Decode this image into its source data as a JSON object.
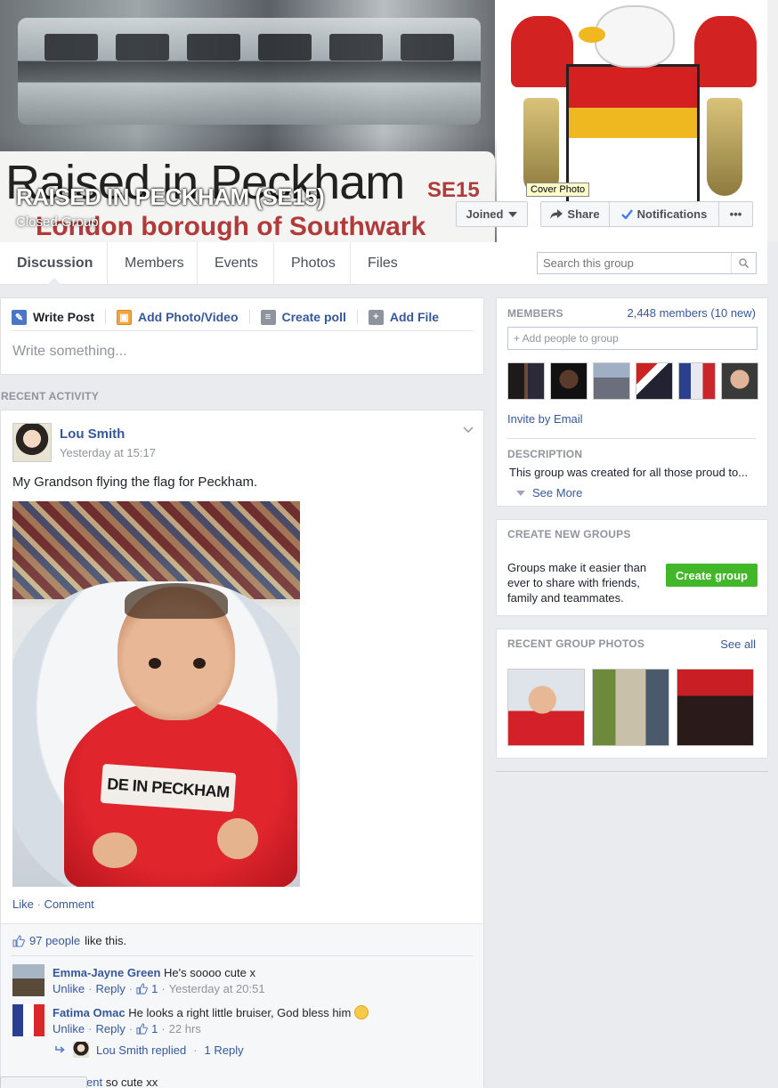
{
  "cover": {
    "sign_text": "Raised in Peckham",
    "sign_code": "SE15",
    "sign_subtext": "London borough of Southwark",
    "tooltip": "Cover Photo"
  },
  "group": {
    "title": "RAISED IN PECKHAM (SE15)",
    "type": "Closed Group"
  },
  "actions": {
    "joined": "Joined",
    "share": "Share",
    "notifications": "Notifications",
    "more": "•••"
  },
  "tabs": [
    {
      "label": "Discussion",
      "active": true
    },
    {
      "label": "Members"
    },
    {
      "label": "Events"
    },
    {
      "label": "Photos"
    },
    {
      "label": "Files"
    }
  ],
  "search": {
    "placeholder": "Search this group"
  },
  "composer": {
    "tabs": [
      "Write Post",
      "Add Photo/Video",
      "Create poll",
      "Add File"
    ],
    "placeholder": "Write something..."
  },
  "recent_activity_label": "RECENT ACTIVITY",
  "post": {
    "author": "Lou Smith",
    "time": "Yesterday at 15:17",
    "text": "My Grandson flying the flag for Peckham.",
    "photo_print": "DE IN PECKHAM",
    "like": "Like",
    "comment": "Comment",
    "likes_count": "97 people",
    "likes_suffix": "like this.",
    "comments": [
      {
        "name": "Emma-Jayne Green",
        "text": "He's soooo cute x",
        "unlike": "Unlike",
        "reply": "Reply",
        "likes": "1",
        "time": "Yesterday at 20:51"
      },
      {
        "name": "Fatima Omac",
        "text": "He looks a right little bruiser, God bless him",
        "unlike": "Unlike",
        "reply": "Reply",
        "likes": "1",
        "time": "22 hrs"
      }
    ],
    "reply_summary_name": "Lou Smith replied",
    "reply_summary_count": "1 Reply",
    "fragment_link": "ent",
    "fragment_text": "so cute xx"
  },
  "members": {
    "label": "MEMBERS",
    "count": "2,448 members (10 new)",
    "add_placeholder": "+ Add people to group",
    "invite": "Invite by Email",
    "description_label": "DESCRIPTION",
    "description": "This group was created for all those proud to...",
    "see_more": "See More"
  },
  "create_groups": {
    "label": "CREATE NEW GROUPS",
    "text": "Groups make it easier than ever to share with friends, family and teammates.",
    "button": "Create group"
  },
  "recent_photos": {
    "label": "RECENT GROUP PHOTOS",
    "see_all": "See all"
  },
  "colors": {
    "link": "#365899",
    "green_button": "#42b72a",
    "page_bg": "#e9ebee"
  }
}
